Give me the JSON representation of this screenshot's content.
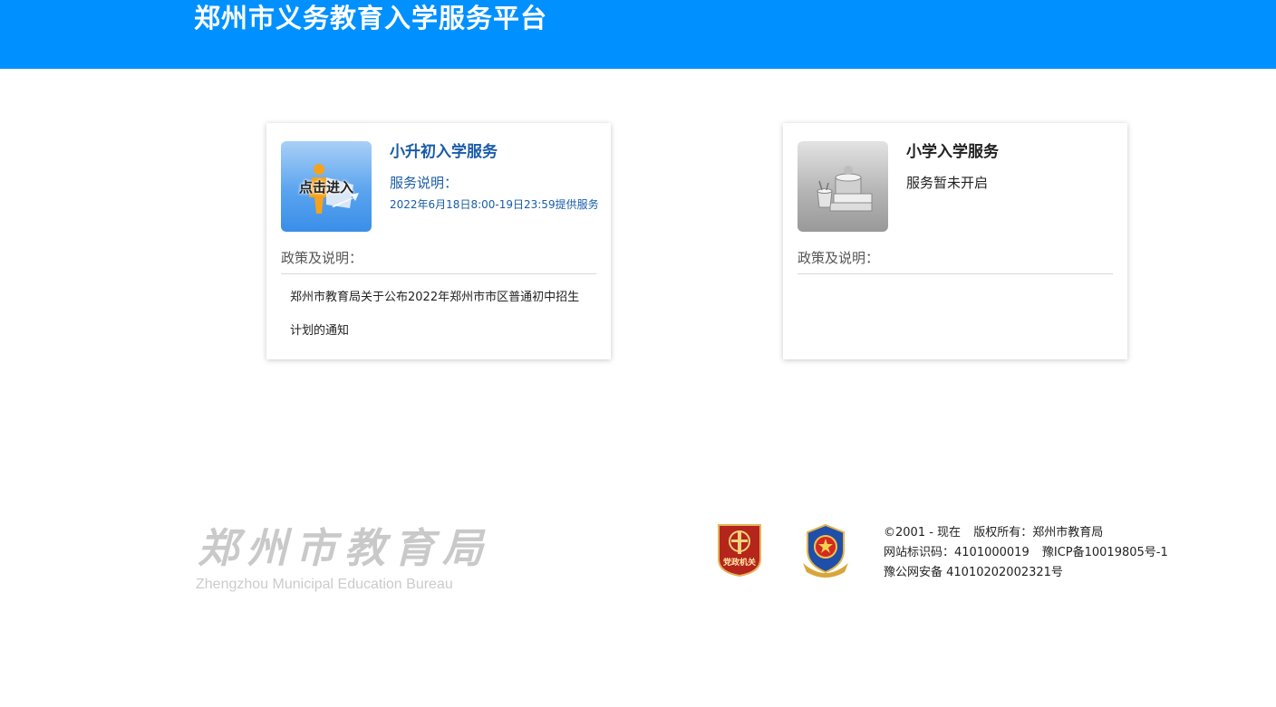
{
  "header": {
    "title": "郑州市义务教育入学服务平台",
    "bg_color": "#0090ff"
  },
  "cards": [
    {
      "title": "小升初入学服务",
      "thumb_label": "点击进入",
      "thumb_icon": "student-with-arrow-icon",
      "desc_label": "服务说明：",
      "desc_time": "2022年6月18日8:00-19日23:59提供服务",
      "policy_label": "政策及说明：",
      "notices": [
        "郑州市教育局关于公布2022年郑州市市区普通初中招生计划的通知"
      ]
    },
    {
      "title": "小学入学服务",
      "thumb_icon": "books-and-pencil-cup-icon",
      "desc_label": "服务暂未开启",
      "policy_label": "政策及说明：",
      "notices": []
    }
  ],
  "footer": {
    "logo_cn": "郑州市教育局",
    "logo_en": "Zhengzhou Municipal Education Bureau",
    "party_badge_text": "党政机关",
    "party_badge_icon": "party-government-badge-icon",
    "police_badge_icon": "police-emblem-icon",
    "copyright_line1_a": "©2001 - 现在",
    "copyright_line1_b": "版权所有：郑州市教育局",
    "copyright_line2_a": "网站标识码：4101000019",
    "copyright_line2_b": "豫ICP备10019805号-1",
    "copyright_line3": "豫公网安备 41010202002321号"
  }
}
